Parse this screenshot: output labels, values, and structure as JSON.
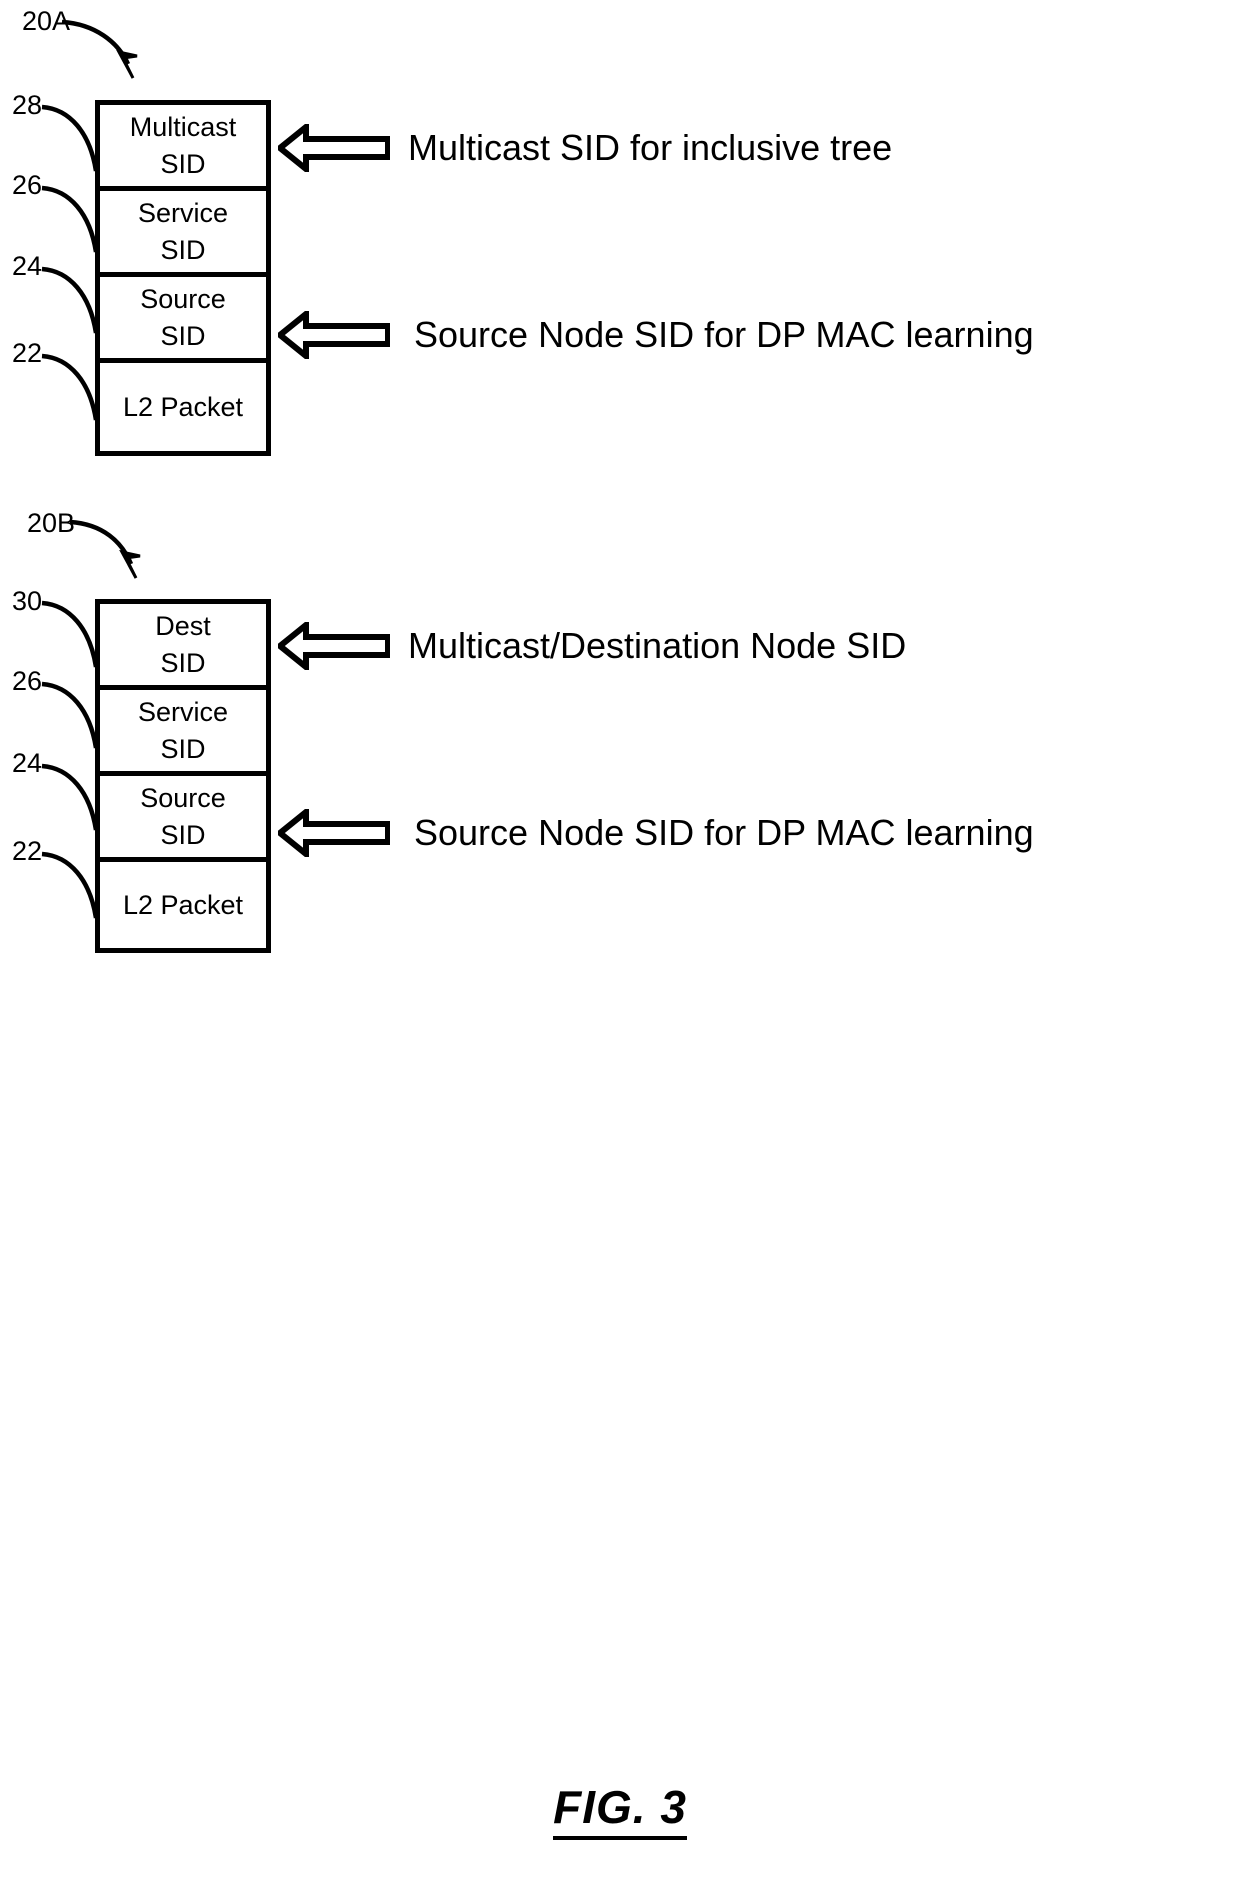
{
  "figure": {
    "caption": "FIG. 3",
    "stacks": [
      {
        "id": "20A",
        "id_label": "20A",
        "cells": [
          {
            "ref": "28",
            "lines": [
              "Multicast",
              "SID"
            ]
          },
          {
            "ref": "26",
            "lines": [
              "Service",
              "SID"
            ]
          },
          {
            "ref": "24",
            "lines": [
              "Source",
              "SID"
            ]
          },
          {
            "ref": "22",
            "lines": [
              "L2 Packet"
            ]
          }
        ],
        "callouts": [
          {
            "target_ref": "28",
            "text": "Multicast SID for inclusive tree"
          },
          {
            "target_ref": "24",
            "text": "Source Node SID for DP MAC learning"
          }
        ]
      },
      {
        "id": "20B",
        "id_label": "20B",
        "cells": [
          {
            "ref": "30",
            "lines": [
              "Dest",
              "SID"
            ]
          },
          {
            "ref": "26",
            "lines": [
              "Service",
              "SID"
            ]
          },
          {
            "ref": "24",
            "lines": [
              "Source",
              "SID"
            ]
          },
          {
            "ref": "22",
            "lines": [
              "L2 Packet"
            ]
          }
        ],
        "callouts": [
          {
            "target_ref": "30",
            "text": "Multicast/Destination Node SID"
          },
          {
            "target_ref": "24",
            "text": "Source Node SID for DP MAC learning"
          }
        ]
      }
    ],
    "colors": {
      "ink": "#000000",
      "paper": "#ffffff"
    }
  }
}
